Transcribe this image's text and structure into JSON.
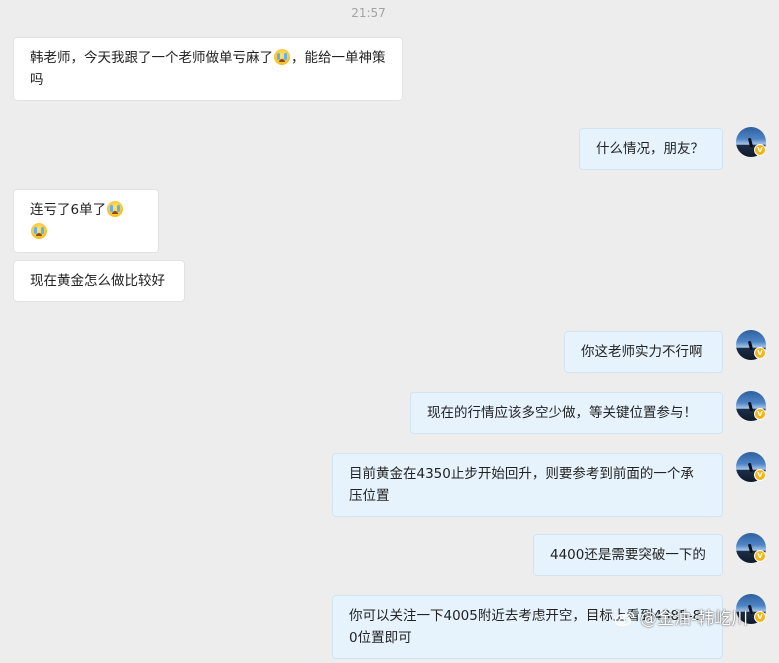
{
  "chat": {
    "timestamp": "21:57",
    "messages": [
      {
        "side": "in",
        "parts": [
          "韩老师，今天我跟了一个老师做单亏麻了",
          "[emoji]",
          "，能给一单神策吗"
        ]
      },
      {
        "side": "out",
        "parts": [
          "什么情况，朋友？"
        ]
      },
      {
        "side": "in",
        "parts": [
          "连亏了6单了",
          "[emoji]",
          "[emoji]"
        ]
      },
      {
        "side": "in",
        "parts": [
          "现在黄金怎么做比较好"
        ]
      },
      {
        "side": "out",
        "parts": [
          "你这老师实力不行啊"
        ]
      },
      {
        "side": "out",
        "parts": [
          "现在的行情应该多空少做，等关键位置参与！"
        ]
      },
      {
        "side": "out",
        "parts": [
          "目前黄金在4350止步开始回升，则要参考到前面的一个承压位置"
        ]
      },
      {
        "side": "out",
        "parts": [
          "4400还是需要突破一下的"
        ]
      },
      {
        "side": "out",
        "parts": [
          "你可以关注一下4005附近去考虑开空，目标上看到4385-80位置即可"
        ]
      }
    ],
    "emoji_icon": "crying-face-icon",
    "avatar_icon": "user-avatar-icon",
    "verified_badge": "V"
  },
  "watermark": {
    "icon": "weibo-logo-icon",
    "text": "@金油-韩屹川"
  },
  "colors": {
    "background": "#ededed",
    "incoming_bubble": "#ffffff",
    "outgoing_bubble": "#e6f3fc",
    "timestamp": "#a3a3a3",
    "verified": "#f3b515"
  }
}
